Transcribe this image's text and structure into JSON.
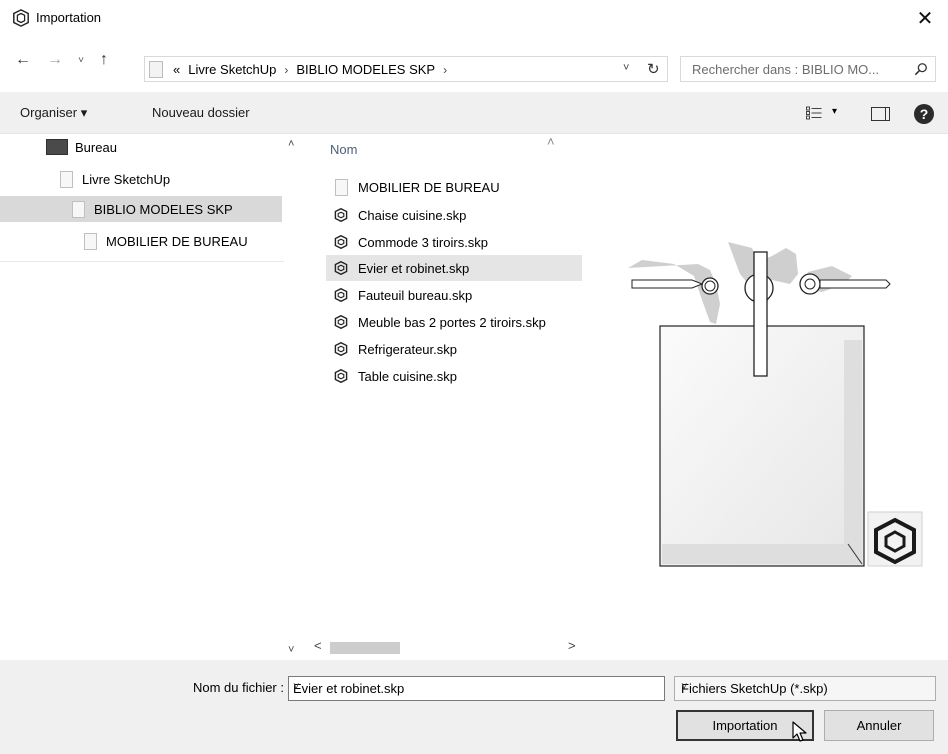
{
  "window": {
    "title": "Importation",
    "close_glyph": "✕"
  },
  "navigation": {
    "back": "←",
    "forward": "→",
    "recent": "˅",
    "up": "↑"
  },
  "address": {
    "overflow": "«",
    "crumbs": [
      "Livre SketchUp",
      "BIBLIO MODELES SKP"
    ],
    "separator": "›",
    "dropdown": "˅",
    "refresh": "↻"
  },
  "search": {
    "placeholder": "Rechercher dans : BIBLIO MO..."
  },
  "toolbar": {
    "organise_label": "Organiser ▾",
    "new_folder_label": "Nouveau dossier",
    "view_dropdown": "▾",
    "help": "?"
  },
  "nav_tree": {
    "items": [
      {
        "label": "Bureau",
        "icon": "desktop-icon"
      },
      {
        "label": "Livre SketchUp",
        "icon": "folder-icon"
      },
      {
        "label": "BIBLIO MODELES SKP",
        "icon": "folder-icon",
        "selected": true
      },
      {
        "label": "MOBILIER DE BUREAU",
        "icon": "folder-icon"
      }
    ],
    "scroll_up": "˄",
    "scroll_down": "˅"
  },
  "file_list": {
    "column_header": "Nom",
    "sort_indicator": "˄",
    "rows": [
      {
        "name": "MOBILIER DE BUREAU",
        "type": "folder"
      },
      {
        "name": "Chaise cuisine.skp",
        "type": "skp"
      },
      {
        "name": "Commode 3 tiroirs.skp",
        "type": "skp"
      },
      {
        "name": "Evier et robinet.skp",
        "type": "skp",
        "selected": true
      },
      {
        "name": "Fauteuil bureau.skp",
        "type": "skp"
      },
      {
        "name": "Meuble bas 2 portes 2 tiroirs.skp",
        "type": "skp"
      },
      {
        "name": "Refrigerateur.skp",
        "type": "skp"
      },
      {
        "name": "Table cuisine.skp",
        "type": "skp"
      }
    ],
    "scroll_left": "<",
    "scroll_right": ">"
  },
  "bottom": {
    "filename_label": "Nom du fichier :",
    "filename_value": "Evier et robinet.skp",
    "dropdown": "˅",
    "filetype_value": "Fichiers SketchUp (*.skp)",
    "import_button": "Importation",
    "cancel_button": "Annuler"
  },
  "colors": {
    "toolbar_bg": "#f0f0f0",
    "selection_bg": "#d9d9d9",
    "header_text": "#4c607a"
  }
}
